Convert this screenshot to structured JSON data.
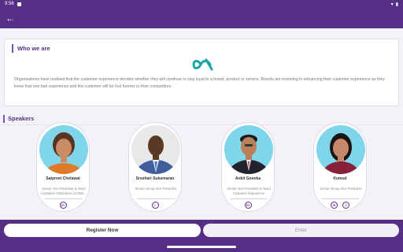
{
  "status_bar": {
    "time": "9:56"
  },
  "who": {
    "title": "Who we are",
    "text": "Organisations have realised that the customer experience decides whether they will continue to stay loyal to a brand, product or service. Brands are investing in enhancing their customer experience as they know that one bad experience and the customer will be lost forever to their competitors."
  },
  "speakers_title": "Speakers",
  "speakers": [
    {
      "name": "Satpreet Chelawat",
      "role": "Senior Vice President & Head Customer Obsession (SOWS...",
      "icons": [
        "linkedin-icon"
      ]
    },
    {
      "name": "Sreehari Sukumaran",
      "role": "Senior Group Vice President",
      "icons": [
        "info-icon"
      ]
    },
    {
      "name": "Ankit Goenka",
      "role": "Senior Vice President & Head Customer Experience",
      "icons": [
        "linkedin-icon"
      ]
    },
    {
      "name": "Kumud",
      "role": "Senior Group Vice President",
      "icons": [
        "linkedin-icon",
        "info-icon"
      ]
    }
  ],
  "buttons": {
    "register": "Register Now",
    "enter": "Enter"
  },
  "colors": {
    "brand": "#552f86",
    "accent": "#7b4cc7",
    "logo": "#1aa6a6"
  }
}
